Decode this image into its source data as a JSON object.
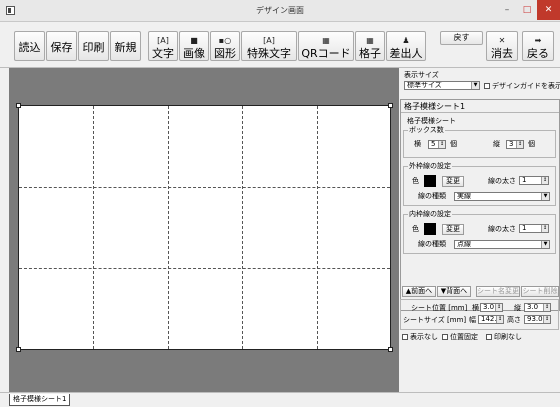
{
  "window": {
    "title": "デザイン画面",
    "minimize": "–",
    "maximize": "□",
    "close": "✕"
  },
  "toolbar": {
    "load": "読込",
    "save": "保存",
    "print": "印刷",
    "new": "新規",
    "text": "文字",
    "image": "画像",
    "shape": "図形",
    "special_text": "特殊文字",
    "qr_code": "QRコード",
    "grid": "格子",
    "sender": "差出人",
    "back": "戻す",
    "delete": "消去",
    "forward": "戻る"
  },
  "display": {
    "size_label": "表示サイズ",
    "size_value": "標準サイズ",
    "guide_label": "デザインガイドを表示"
  },
  "panel": {
    "header": "格子模様シート1",
    "subtitle": "格子模様シート",
    "box_count_label": "ボックス数",
    "cols_label": "横",
    "cols_value": "5",
    "cols_unit": "個",
    "rows_label": "縦",
    "rows_value": "3",
    "rows_unit": "個",
    "outer": {
      "title": "外枠線の設定",
      "color_label": "色",
      "change_label": "変更",
      "width_label": "線の太さ",
      "width_value": "1",
      "type_label": "線の種類",
      "type_value": "実線"
    },
    "inner": {
      "title": "内枠線の設定",
      "color_label": "色",
      "change_label": "変更",
      "width_label": "線の太さ",
      "width_value": "1",
      "type_label": "線の種類",
      "type_value": "点線"
    }
  },
  "layer": {
    "front": "▲前面へ",
    "back": "▼背面へ",
    "rename": "シート名変更",
    "delete": "シート削除"
  },
  "position": {
    "pos_label": "シート位置 [mm]",
    "x_label": "横",
    "x_value": "3.0",
    "y_label": "縦",
    "y_value": "3.0",
    "size_label": "シートサイズ [mm]",
    "w_label": "幅",
    "w_value": "142.0",
    "h_label": "高さ",
    "h_value": "93.0",
    "hide": "表示なし",
    "lock": "位置固定",
    "noprint": "印刷なし"
  },
  "status": {
    "sheet_tab": "格子模様シート1"
  },
  "colors": {
    "canvas_bg": "#7b7b7b",
    "close_button": "#c0392b"
  }
}
